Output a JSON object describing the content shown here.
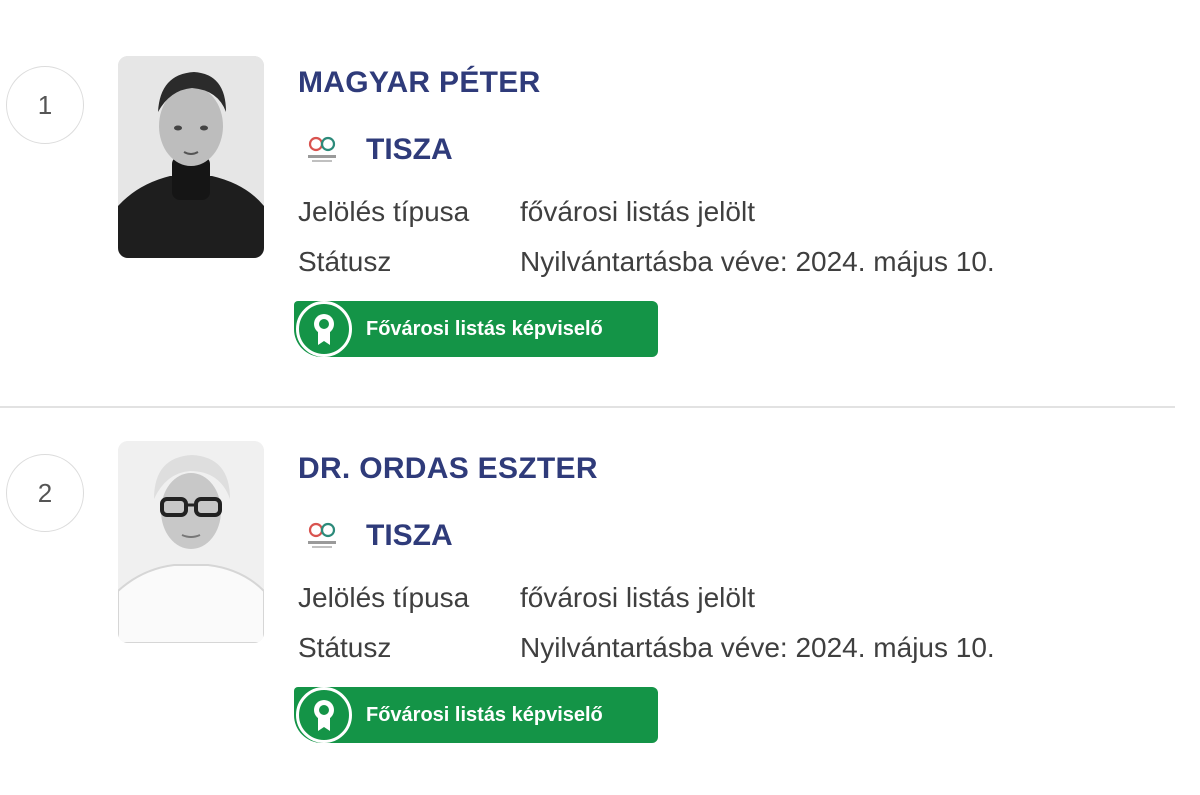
{
  "candidates": [
    {
      "rank": "1",
      "name": "MAGYAR PÉTER",
      "party": "TISZA",
      "nomination_label": "Jelölés típusa",
      "nomination_value": "fővárosi listás jelölt",
      "status_label": "Státusz",
      "status_value": "Nyilvántartásba véve: 2024. május 10.",
      "badge": "Fővárosi listás képviselő",
      "photo_icon": "man-portrait"
    },
    {
      "rank": "2",
      "name": "DR. ORDAS ESZTER",
      "party": "TISZA",
      "nomination_label": "Jelölés típusa",
      "nomination_value": "fővárosi listás jelölt",
      "status_label": "Státusz",
      "status_value": "Nyilvántartásba véve: 2024. május 10.",
      "badge": "Fővárosi listás képviselő",
      "photo_icon": "woman-portrait"
    }
  ],
  "colors": {
    "name": "#2f3b7a",
    "badge": "#149447",
    "divider": "#e2e2e2"
  }
}
